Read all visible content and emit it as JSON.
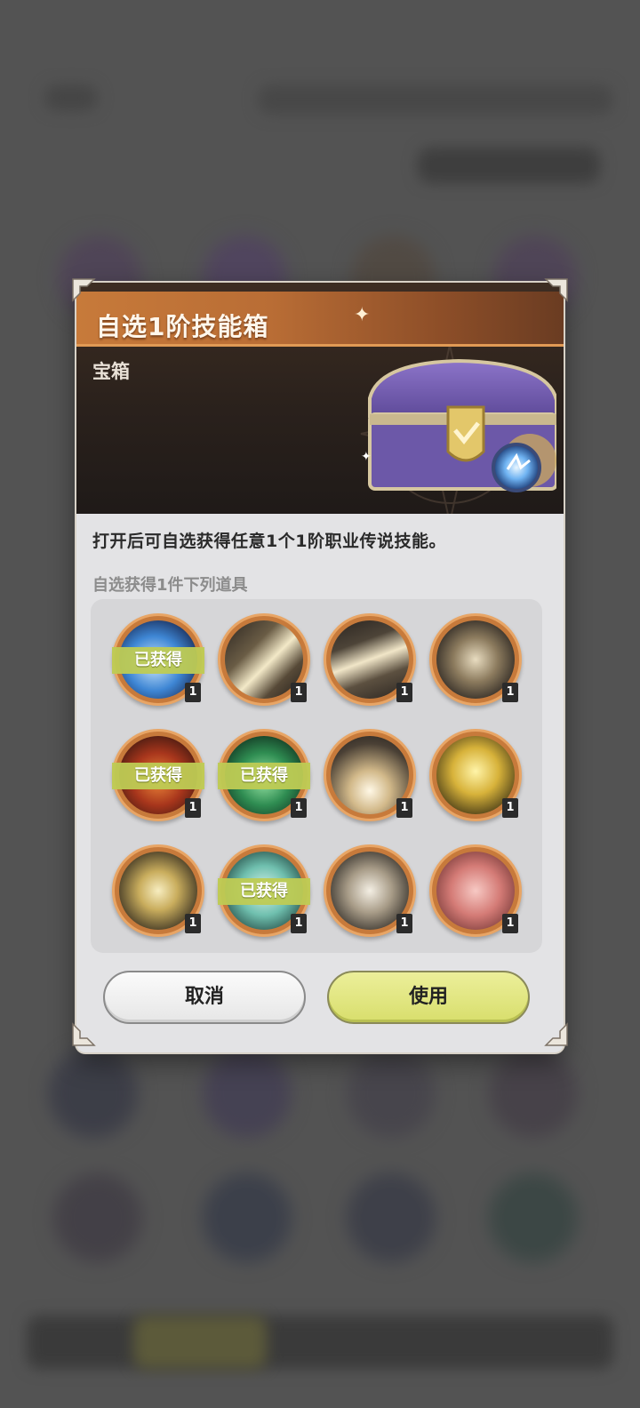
{
  "modal": {
    "title": "自选1阶技能箱",
    "type_label": "宝箱",
    "description": "打开后可自选获得任意1个1阶职业传说技能。",
    "list_title": "自选获得1件下列道具",
    "owned_badge": "已获得",
    "items": [
      {
        "icon": "blue-frost-burst-icon",
        "qty": "1",
        "owned": true
      },
      {
        "icon": "sword-slash-icon",
        "qty": "1",
        "owned": false
      },
      {
        "icon": "wind-slash-icon",
        "qty": "1",
        "owned": false
      },
      {
        "icon": "swirl-cycle-icon",
        "qty": "1",
        "owned": false
      },
      {
        "icon": "fire-vortex-icon",
        "qty": "1",
        "owned": true
      },
      {
        "icon": "green-wind-icon",
        "qty": "1",
        "owned": true
      },
      {
        "icon": "light-burst-icon",
        "qty": "1",
        "owned": false
      },
      {
        "icon": "golden-crystal-icon",
        "qty": "1",
        "owned": false
      },
      {
        "icon": "eye-pyramid-icon",
        "qty": "1",
        "owned": false
      },
      {
        "icon": "shield-crest-icon",
        "qty": "1",
        "owned": true
      },
      {
        "icon": "dagger-compass-icon",
        "qty": "1",
        "owned": false
      },
      {
        "icon": "sword-cross-icon",
        "qty": "1",
        "owned": false
      }
    ],
    "cancel_label": "取消",
    "use_label": "使用"
  },
  "colors": {
    "accent_orange": "#c77a3a",
    "owned_green": "#becb54",
    "use_button": "#dde270"
  }
}
